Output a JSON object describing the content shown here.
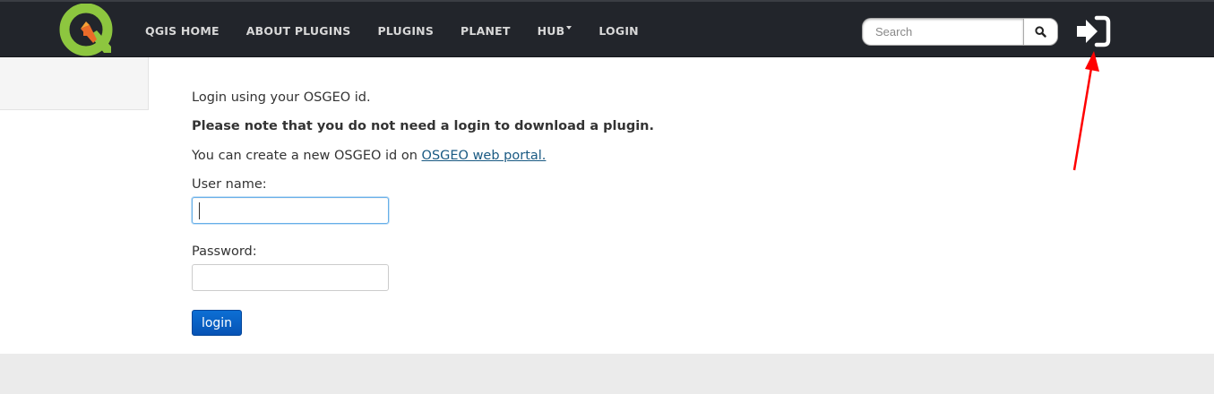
{
  "header": {
    "logo_icon": "qgis-logo-icon",
    "nav": [
      {
        "label": "QGIS HOME"
      },
      {
        "label": "ABOUT PLUGINS"
      },
      {
        "label": "PLUGINS"
      },
      {
        "label": "PLANET"
      },
      {
        "label": "HUB",
        "has_dropdown": true
      },
      {
        "label": "LOGIN"
      }
    ],
    "search": {
      "placeholder": "Search",
      "value": "",
      "icon": "search-icon"
    },
    "login_icon": "sign-in-icon"
  },
  "annotation": {
    "type": "arrow",
    "color": "#ff0000",
    "points_to": "sign-in-icon"
  },
  "main": {
    "intro": "Login using your OSGEO id.",
    "note": "Please note that you do not need a login to download a plugin.",
    "create_prefix": "You can create a new OSGEO id on ",
    "create_link": "OSGEO web portal.",
    "username_label": "User name:",
    "username_value": "",
    "password_label": "Password:",
    "password_value": "",
    "login_button": "login"
  },
  "colors": {
    "navbar_bg": "#22252b",
    "nav_text": "#d8d8d8",
    "link": "#1a5a83",
    "button_bg": "#0b63c9",
    "focus_border": "#66afe9",
    "logo_green": "#8dc63f"
  }
}
